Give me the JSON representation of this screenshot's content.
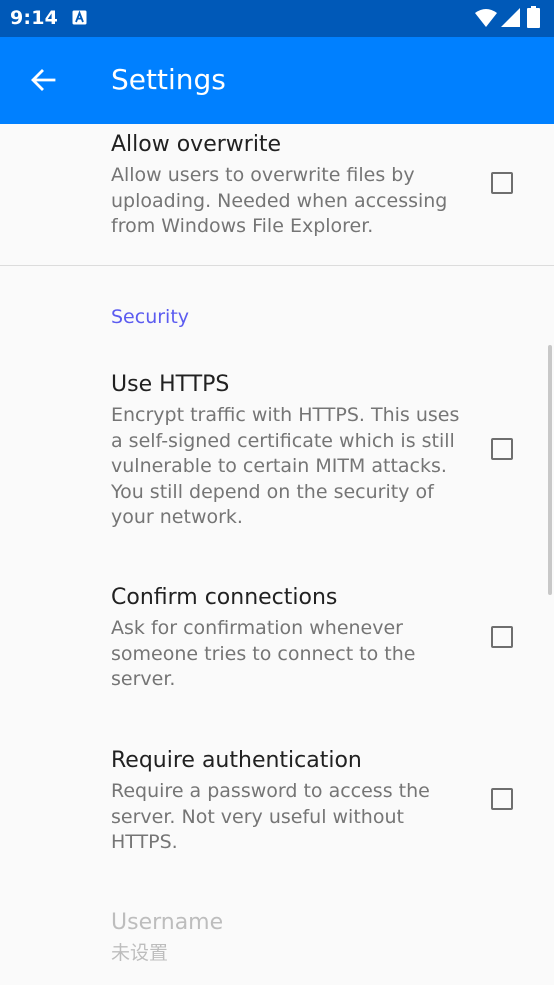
{
  "status_bar": {
    "time": "9:14",
    "icons": [
      "app-notification-icon",
      "wifi-icon",
      "signal-icon",
      "battery-icon"
    ]
  },
  "app_bar": {
    "title": "Settings",
    "back_icon": "arrow-back-icon"
  },
  "colors": {
    "status_bar": "#0059b8",
    "app_bar": "#0080ff",
    "category": "#5b5bf0",
    "title_text": "#212121",
    "summary_text": "#757575",
    "disabled_text": "#bdbdbd"
  },
  "prefs": {
    "allow_overwrite": {
      "title": "Allow overwrite",
      "summary": "Allow users to overwrite files by uploading. Needed when accessing from Windows File Explorer.",
      "checked": false
    },
    "security_category": "Security",
    "use_https": {
      "title": "Use HTTPS",
      "summary": "Encrypt traffic with HTTPS. This uses a self-signed certificate which is still vulnerable to certain MITM attacks. You still depend on the security of your network.",
      "checked": false
    },
    "confirm_connections": {
      "title": "Confirm connections",
      "summary": "Ask for confirmation whenever someone tries to connect to the server.",
      "checked": false
    },
    "require_auth": {
      "title": "Require authentication",
      "summary": "Require a password to access the server. Not very useful without HTTPS.",
      "checked": false
    },
    "username": {
      "title": "Username",
      "summary": "未设置"
    }
  }
}
